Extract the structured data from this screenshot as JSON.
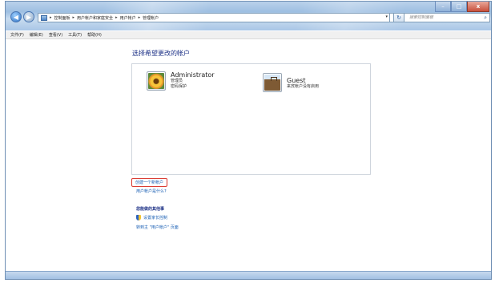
{
  "window": {
    "controls": {
      "minimize": "–",
      "maximize": "□",
      "close": "x"
    }
  },
  "nav": {
    "back": "◀",
    "forward": "▶"
  },
  "address": {
    "breadcrumbs": [
      "控制面板",
      "用户帐户和家庭安全",
      "用户帐户",
      "管理帐户"
    ],
    "separator": "▸",
    "dropdown": "▾",
    "refresh": "↻"
  },
  "search": {
    "placeholder": "搜索控制面板"
  },
  "menubar": [
    "文件(F)",
    "编辑(E)",
    "查看(V)",
    "工具(T)",
    "帮助(H)"
  ],
  "main": {
    "heading": "选择希望更改的帐户",
    "accounts": [
      {
        "name": "Administrator",
        "lines": [
          "管理员",
          "密码保护"
        ],
        "icon": "sunflower-avatar-icon"
      },
      {
        "name": "Guest",
        "lines": [
          "来宾帐户没有启用"
        ],
        "icon": "briefcase-avatar-icon"
      }
    ],
    "links": {
      "create_account": "创建一个新帐户",
      "what_is": "用户帐户是什么?"
    },
    "other_tasks": {
      "title": "您能做的其他事",
      "items": [
        {
          "label": "设置家长控制",
          "icon": "shield-icon"
        },
        {
          "label": "转到主 \"用户帐户\" 页面",
          "icon": ""
        }
      ]
    }
  },
  "colors": {
    "link": "#1a5fb4",
    "heading": "#1e3287",
    "highlight_border": "#d9342b",
    "chrome": "#9ebfe2"
  }
}
